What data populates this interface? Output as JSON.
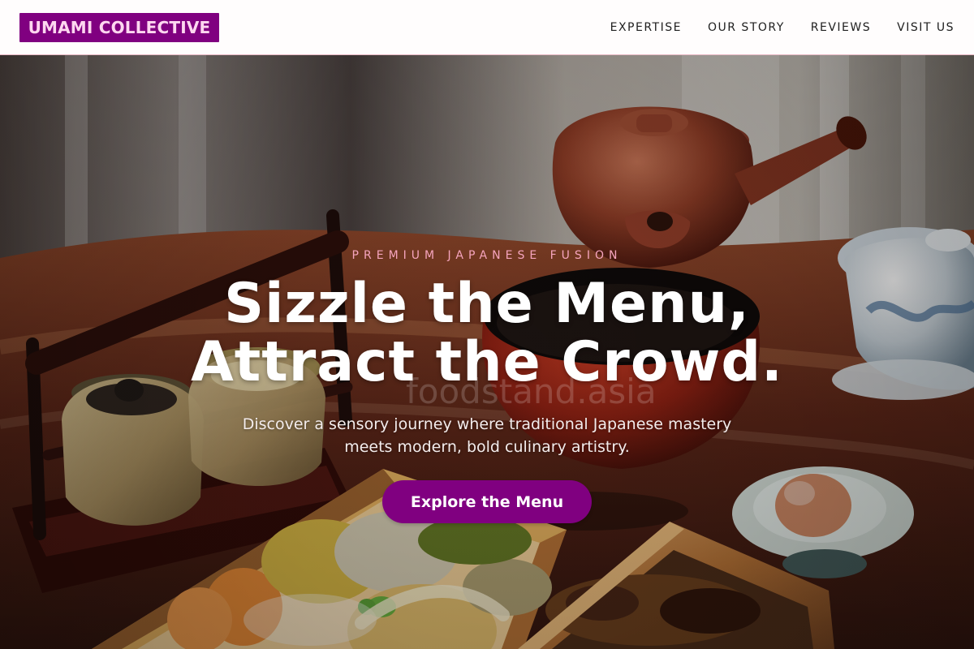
{
  "header": {
    "brand": "UMAMI COLLECTIVE",
    "nav": [
      "EXPERTISE",
      "OUR STORY",
      "REVIEWS",
      "VISIT US"
    ]
  },
  "hero": {
    "eyebrow": "PREMIUM JAPANESE FUSION",
    "title_line_1": "Sizzle the Menu,",
    "title_line_2": "Attract the Crowd.",
    "watermark": "foodstand.asia",
    "description": "Discover a sensory journey where traditional Japanese mastery meets modern, bold culinary artistry.",
    "cta_label": "Explore the Menu"
  },
  "colors": {
    "brand": "#800080",
    "brand_text": "#ffd7f0",
    "accent": "#f5a4bd",
    "header_bg": "#fffdfd"
  }
}
